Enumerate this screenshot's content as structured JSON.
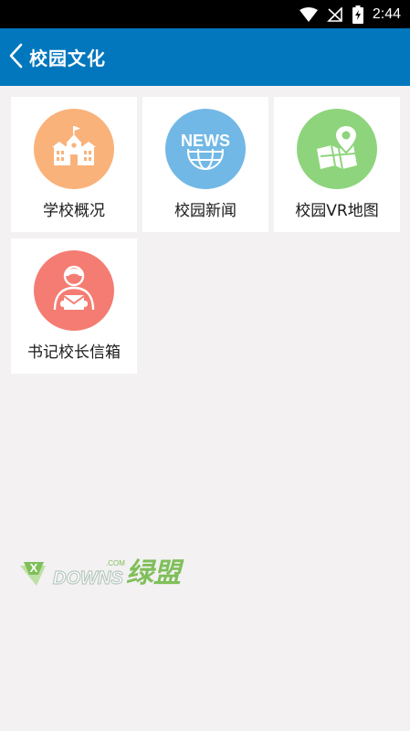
{
  "status_bar": {
    "time": "2:44",
    "icons": [
      "wifi-icon",
      "no-signal-icon",
      "battery-charging-icon"
    ]
  },
  "app_bar": {
    "title": "校园文化",
    "back_icon": "chevron-left-icon"
  },
  "tiles": [
    {
      "label": "学校概况",
      "icon": "school-building-icon",
      "color": "#f9b27a"
    },
    {
      "label": "校园新闻",
      "icon": "news-globe-icon",
      "color": "#72b8e6",
      "icon_text": "NEWS"
    },
    {
      "label": "校园VR地图",
      "icon": "map-pin-icon",
      "color": "#8ed47c"
    },
    {
      "label": "书记校长信箱",
      "icon": "person-mailbox-icon",
      "color": "#f47c72"
    }
  ],
  "watermark": {
    "brand_left": "DOWNS",
    "brand_cn": "绿盟",
    "badge": "X",
    "com": ".COM"
  },
  "colors": {
    "app_bar": "#0277bd",
    "background": "#f3f1f2",
    "status_bar": "#000000"
  }
}
